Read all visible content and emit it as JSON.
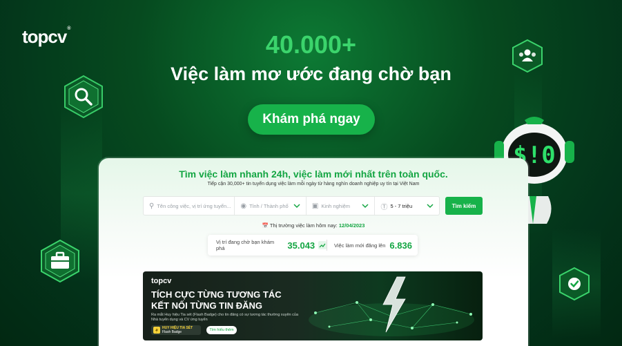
{
  "brand": {
    "logo": "topcv",
    "reg": "®"
  },
  "hero": {
    "count": "40.000+",
    "subtitle": "Việc làm mơ ước đang chờ bạn",
    "cta_label": "Khám phá ngay"
  },
  "icons": {
    "search": "search-icon",
    "users": "users-icon",
    "briefcase": "briefcase-icon",
    "check": "check-badge-icon",
    "robot_screen": "$!0"
  },
  "panel": {
    "title": "Tìm việc làm nhanh 24h, việc làm mới nhất trên toàn quốc.",
    "subtitle": "Tiếp cận 30,000+ tin tuyển dụng việc làm mỗi ngày từ hàng nghìn doanh nghiệp uy tín tại Việt Nam",
    "search": {
      "keyword_placeholder": "Tên công việc, vị trí ứng tuyển...",
      "location_placeholder": "Tỉnh / Thành phố",
      "experience_placeholder": "Kinh nghiệm",
      "salary_value": "5 - 7 triệu",
      "button_label": "Tìm kiếm"
    },
    "market": {
      "label": "Thị trường việc làm hôm nay:",
      "date": "12/04/2023"
    },
    "stats": {
      "jobs_label": "Vị trí đang chờ bạn khám phá",
      "jobs_value": "35.043",
      "new_label": "Việc làm mới đăng lên",
      "new_value": "6.836"
    },
    "banner": {
      "logo": "topcv",
      "line1": "TÍCH CỰC TỪNG TƯƠNG TÁC",
      "line2": "KẾT NỐI TỪNG TIN ĐĂNG",
      "desc": "Ra mắt Huy hiệu Tia sét (Flash Badge) cho tin đăng có sự tương tác thường xuyên của Nhà tuyển dụng và CV ứng tuyển",
      "badge_title": "HUY HIỆU TIA SÉT",
      "badge_sub": "Flash Badge",
      "more_label": "Tìm hiểu thêm"
    }
  },
  "colors": {
    "accent": "#17b24a",
    "bg_dark": "#03331a",
    "hero_count": "#3bd46c"
  }
}
